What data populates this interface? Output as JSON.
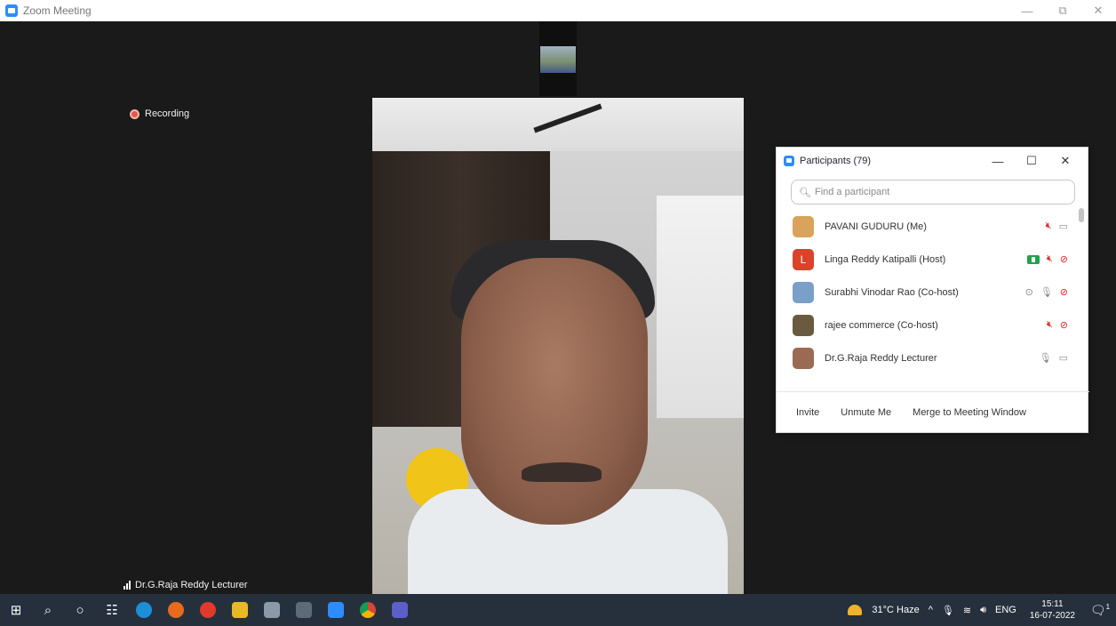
{
  "window": {
    "title": "Zoom Meeting",
    "minimize": "—",
    "restore": "⧉",
    "close": "✕"
  },
  "stage": {
    "recording_label": "Recording",
    "speaker_name": "Dr.G.Raja Reddy Lecturer"
  },
  "participants_panel": {
    "title": "Participants (79)",
    "controls": {
      "minimize": "—",
      "maximize": "☐",
      "close": "✕"
    },
    "search_placeholder": "Find a participant",
    "participants": [
      {
        "name": "PAVANI GUDURU (Me)",
        "avatar": "photo",
        "avatar_color": "#d9a35b",
        "sharing": false,
        "status": "",
        "mic": "muted",
        "video": "on"
      },
      {
        "name": "Linga Reddy Katipalli (Host)",
        "avatar": "L",
        "avatar_color": "#d9432a",
        "sharing": true,
        "status": "",
        "mic": "muted",
        "video": "off"
      },
      {
        "name": "Surabhi Vinodar Rao (Co-host)",
        "avatar": "photo",
        "avatar_color": "#7aa0c8",
        "sharing": false,
        "status": "⊙",
        "mic": "on",
        "video": "off"
      },
      {
        "name": "rajee commerce (Co-host)",
        "avatar": "photo",
        "avatar_color": "#6a5a40",
        "sharing": false,
        "status": "",
        "mic": "muted",
        "video": "off"
      },
      {
        "name": "Dr.G.Raja Reddy Lecturer",
        "avatar": "photo",
        "avatar_color": "#9b6a52",
        "sharing": false,
        "status": "",
        "mic": "talking",
        "video": "on"
      }
    ],
    "footer": {
      "invite": "Invite",
      "unmute": "Unmute Me",
      "merge": "Merge to Meeting Window"
    }
  },
  "taskbar": {
    "weather": "31°C Haze",
    "language": "ENG",
    "time": "15:11",
    "date": "16-07-2022",
    "notification_count": "1"
  },
  "colors": {
    "zoom_blue": "#2d8cff",
    "muted_red": "#e02828",
    "share_green": "#1fa24a",
    "recording_red": "#e05b4d",
    "taskbar_bg": "#26303c"
  }
}
